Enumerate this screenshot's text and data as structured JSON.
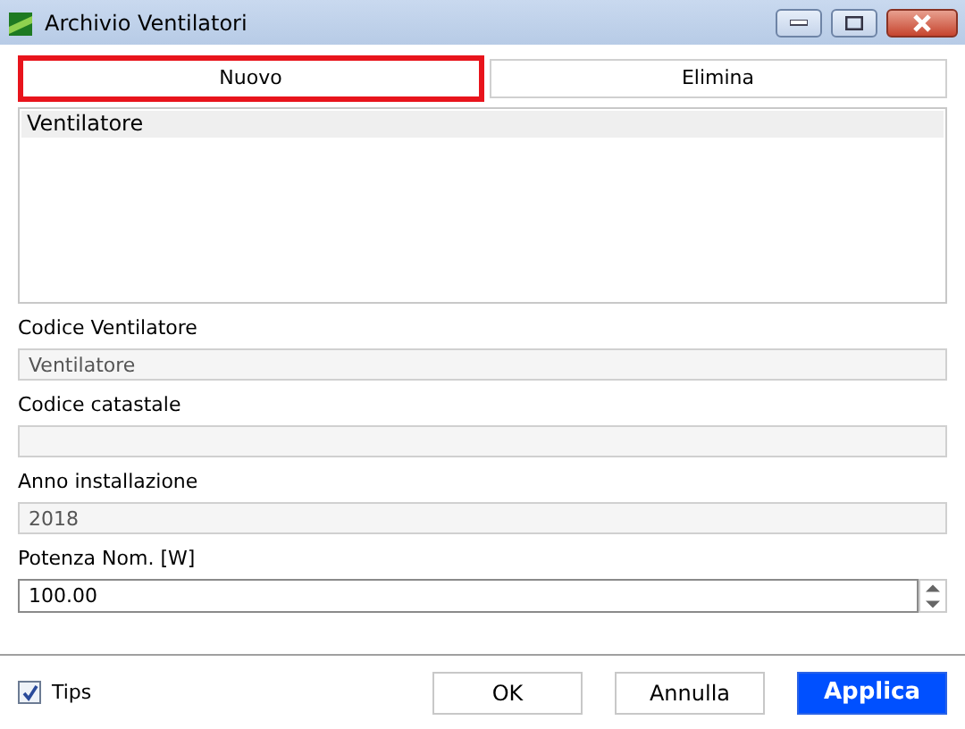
{
  "window": {
    "title": "Archivio Ventilatori"
  },
  "actions": [
    {
      "label": "Nuovo",
      "highlighted": true
    },
    {
      "label": "Elimina",
      "highlighted": false
    }
  ],
  "list": {
    "columns": [
      "Ventilatore"
    ]
  },
  "fields": [
    {
      "label": "Codice Ventilatore",
      "value": "Ventilatore",
      "kind": "text",
      "disabled": true
    },
    {
      "label": "Codice catastale",
      "kind": "text",
      "disabled": true
    },
    {
      "label": "Anno installazione",
      "value": "2018",
      "kind": "text",
      "disabled": true
    },
    {
      "label": "Potenza Nom. [W]",
      "value": "100.00",
      "kind": "spin",
      "disabled": false
    }
  ],
  "tips": {
    "label": "Tips",
    "checked": true
  },
  "buttons": [
    {
      "label": "OK",
      "kind": "normal"
    },
    {
      "label": "Annulla",
      "kind": "normal"
    },
    {
      "label": "Applica",
      "kind": "primary"
    }
  ]
}
